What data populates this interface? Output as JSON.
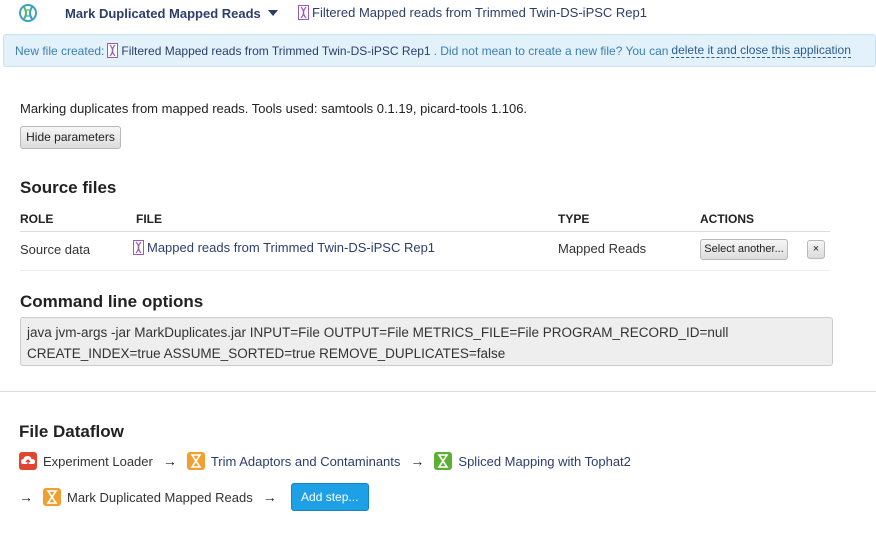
{
  "header": {
    "app_name": "Mark Duplicated Mapped Reads",
    "file_name": "Filtered Mapped reads from Trimmed Twin-DS-iPSC Rep1"
  },
  "notice": {
    "prefix": "New file created:",
    "file_name": "Filtered Mapped reads from Trimmed Twin-DS-iPSC Rep1",
    "middle": ". Did not mean to create a new file? You can",
    "link": "delete it and close this application"
  },
  "description": "Marking duplicates from mapped reads. Tools used: samtools 0.1.19, picard-tools 1.106.",
  "hide_button": "Hide parameters",
  "source_files": {
    "title": "Source files",
    "headers": [
      "ROLE",
      "FILE",
      "TYPE",
      "ACTIONS"
    ],
    "rows": [
      {
        "role": "Source data",
        "file": "Mapped reads from Trimmed Twin-DS-iPSC Rep1",
        "type": "Mapped Reads",
        "action": "Select another...",
        "remove": "×"
      }
    ]
  },
  "command_line": {
    "title": "Command line options",
    "line1": "java jvm-args -jar MarkDuplicates.jar INPUT=File OUTPUT=File METRICS_FILE=File PROGRAM_RECORD_ID=null",
    "line2": "CREATE_INDEX=true ASSUME_SORTED=true REMOVE_DUPLICATES=false"
  },
  "dataflow": {
    "title": "File Dataflow",
    "arrow": "→",
    "steps": [
      {
        "label": "Experiment Loader",
        "icon": "cloud-upload-icon",
        "color": "#e0452f",
        "link": false
      },
      {
        "label": "Trim Adaptors and Contaminants",
        "icon": "hourglass-icon",
        "color": "#f0a030",
        "link": true
      },
      {
        "label": "Spliced Mapping with Tophat2",
        "icon": "hourglass-icon",
        "color": "#5bb033",
        "link": true
      },
      {
        "label": "Mark Duplicated Mapped Reads",
        "icon": "hourglass-icon",
        "color": "#f0a030",
        "link": false
      }
    ],
    "add_button": "Add step..."
  },
  "colors": {
    "link": "#2c3e6b",
    "notice_bg": "#e2f1fa",
    "add_button": "#1ea0e6"
  }
}
